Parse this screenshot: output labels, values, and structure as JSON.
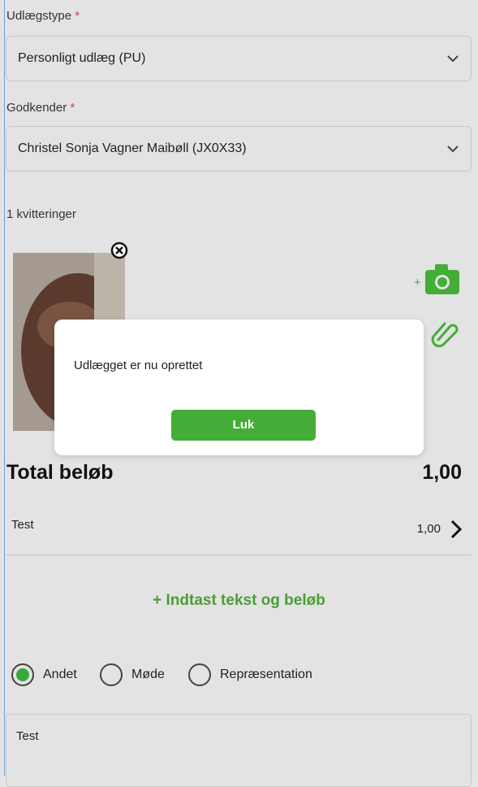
{
  "form": {
    "type_label": "Udlægstype",
    "type_value": "Personligt udlæg (PU)",
    "approver_label": "Godkender",
    "approver_value": "Christel Sonja Vagner Maibøll (JX0X33)",
    "required_mark": "*",
    "receipts_count": "1 kvitteringer"
  },
  "totals": {
    "label": "Total beløb",
    "value": "1,00"
  },
  "lines": [
    {
      "text": "Test",
      "amount": "1,00"
    }
  ],
  "add_line_label": "+ Indtast tekst og beløb",
  "category": {
    "options": [
      "Andet",
      "Møde",
      "Repræsentation"
    ],
    "selected": "Andet"
  },
  "description_value": "Test",
  "dialog": {
    "message": "Udlægget er nu oprettet",
    "button_label": "Luk"
  },
  "colors": {
    "accent": "#44ad37",
    "required": "#d0443a"
  },
  "icons": [
    "chevron-down-icon",
    "remove-receipt-icon",
    "add-camera-icon",
    "paperclip-icon",
    "chevron-right-icon"
  ]
}
